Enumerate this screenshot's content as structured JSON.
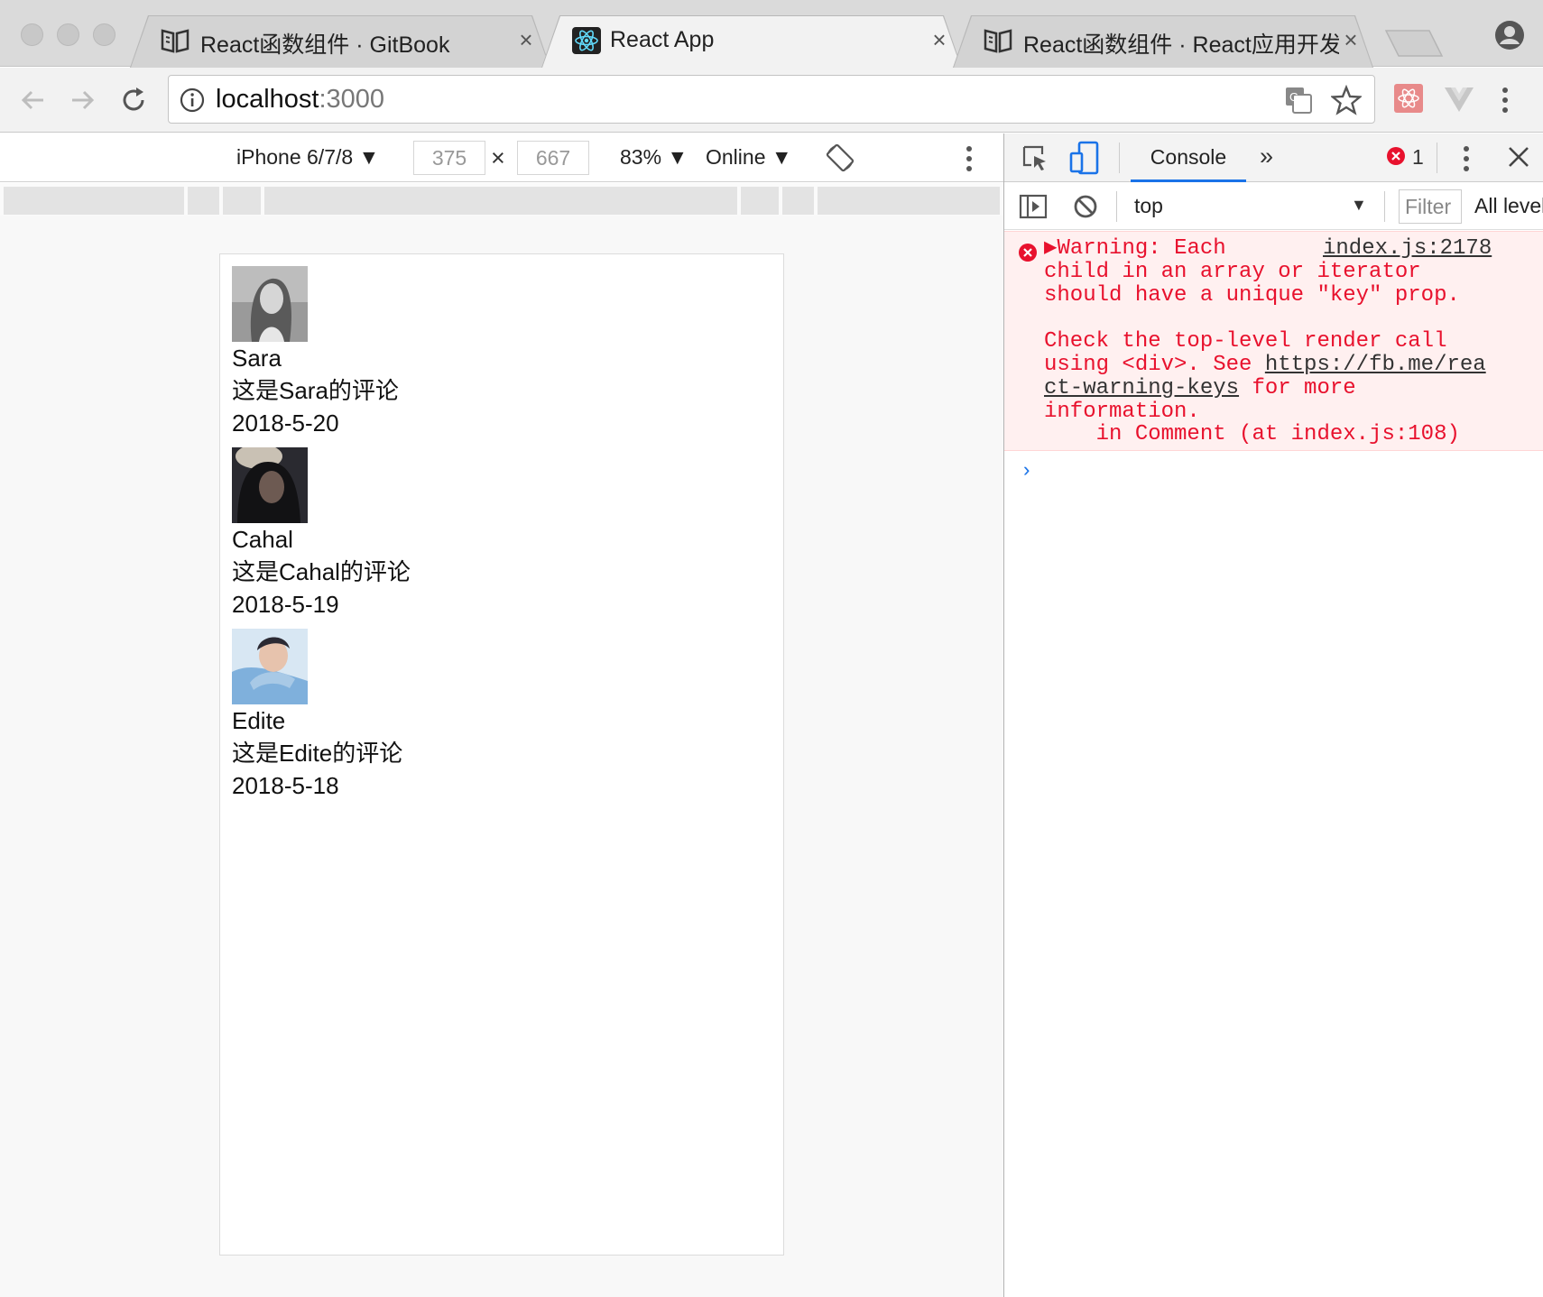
{
  "browser": {
    "tabs": [
      {
        "title": "React函数组件 · GitBook",
        "icon": "gitbook-icon",
        "active": false
      },
      {
        "title": "React App",
        "icon": "react-icon",
        "active": true
      },
      {
        "title": "React函数组件 · React应用开发",
        "icon": "gitbook-icon",
        "active": false
      }
    ],
    "url_host": "localhost",
    "url_port": ":3000"
  },
  "device_toolbar": {
    "device": "iPhone 6/7/8 ▼",
    "width": "375",
    "height": "667",
    "zoom": "83% ▼",
    "throttling": "Online ▼"
  },
  "comments": [
    {
      "author": "Sara",
      "text": "这是Sara的评论",
      "date": "2018-5-20"
    },
    {
      "author": "Cahal",
      "text": "这是Cahal的评论",
      "date": "2018-5-19"
    },
    {
      "author": "Edite",
      "text": "这是Edite的评论",
      "date": "2018-5-18"
    }
  ],
  "devtools": {
    "active_tab": "Console",
    "error_count": "1",
    "context": "top",
    "filter_placeholder": "Filter",
    "levels": "All levels",
    "message": {
      "line1": "▶Warning: Each",
      "source": "index.js:2178",
      "line2": "child in an array or iterator",
      "line3": "should have a unique \"key\" prop.",
      "line4": "Check the top-level render call",
      "line5_a": "using <div>. See ",
      "line5_link": "https://fb.me/rea",
      "line6_link": "ct-warning-keys",
      "line6_b": " for more",
      "line7": "information.",
      "line8": "    in Comment (at index.js:108)"
    },
    "prompt": "›"
  },
  "colors": {
    "error_red": "#e8112d",
    "error_bg": "#fff0f0",
    "accent_blue": "#1a73e8"
  }
}
